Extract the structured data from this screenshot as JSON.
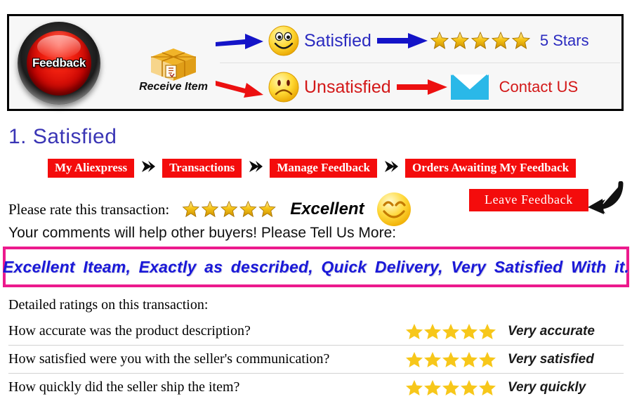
{
  "banner": {
    "feedback_button_label": "Feedback",
    "receive_item_label": "Receive Item",
    "package_icon": "cardboard-box-icon",
    "rows": [
      {
        "arrow_icon": "blue-right-arrow-icon",
        "face_icon": "smiley-happy-icon",
        "mood": "Satisfied",
        "mood_color": "#2b2bc0",
        "result_arrow_icon": "blue-right-arrow-icon",
        "result_icon": "five-gold-stars-icon",
        "result_label": "5 Stars",
        "result_label_color": "#2b2bc0",
        "star_count": 5
      },
      {
        "arrow_icon": "red-right-arrow-icon",
        "face_icon": "smiley-sad-icon",
        "mood": "Unsatisfied",
        "mood_color": "#d31818",
        "result_arrow_icon": "red-right-arrow-icon",
        "result_icon": "envelope-icon",
        "result_label": "Contact US",
        "result_label_color": "#d31818",
        "star_count": 0
      }
    ]
  },
  "section": {
    "heading": "1. Satisfied",
    "heading_color": "#3a35b5"
  },
  "breadcrumb": {
    "separator_icon": "black-chevron-right-icon",
    "item_bg_color": "#f40c0c",
    "items": [
      {
        "label": "My Aliexpress"
      },
      {
        "label": "Transactions"
      },
      {
        "label": "Manage Feedback"
      },
      {
        "label": "Orders Awaiting My Feedback"
      }
    ]
  },
  "rate": {
    "label": "Please rate this transaction:",
    "star_count": 5,
    "rating_word": "Excellent",
    "face_icon": "smiley-happy-big-icon",
    "leave_feedback_label": "Leave Feedback",
    "pointer_icon": "curved-arrow-icon"
  },
  "comments": {
    "prompt": "Your comments will help other buyers! Please Tell Us More:",
    "value": "Excellent Iteam, Exactly as described, Quick Delivery, Very Satisfied With it.",
    "box_border_color": "#ec1a8d",
    "text_color": "#1a18d8"
  },
  "detailed": {
    "title": "Detailed ratings on this transaction:",
    "star_color": "#f7c71a",
    "rows": [
      {
        "question": "How accurate was the product description?",
        "stars": 5,
        "word": "Very accurate"
      },
      {
        "question": "How satisfied were you with the seller's communication?",
        "stars": 5,
        "word": "Very satisfied"
      },
      {
        "question": "How quickly did the seller ship the item?",
        "stars": 5,
        "word": "Very quickly"
      }
    ]
  }
}
